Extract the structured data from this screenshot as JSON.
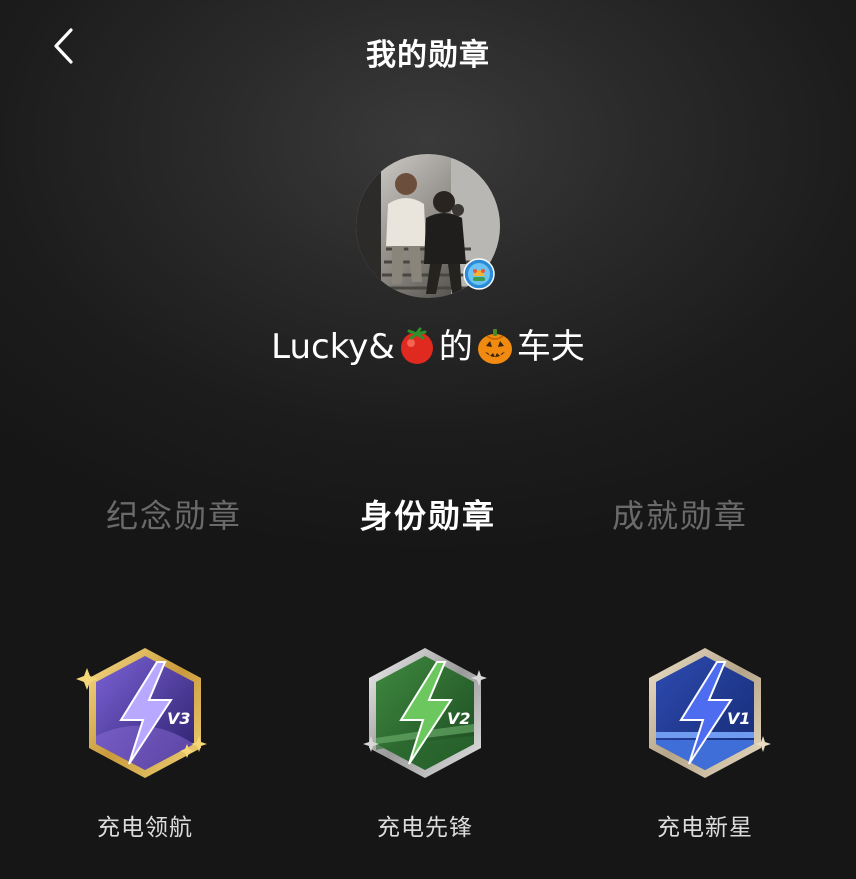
{
  "header": {
    "title": "我的勋章",
    "back_icon": "chevron-left-icon"
  },
  "profile": {
    "avatar": "user-photo-avatar",
    "name_parts": [
      "Lucky&",
      "的",
      "车夫"
    ],
    "name_emojis": [
      "tomato",
      "jack-o-lantern"
    ]
  },
  "tabs": [
    {
      "label": "纪念勋章",
      "active": false
    },
    {
      "label": "身份勋章",
      "active": true
    },
    {
      "label": "成就勋章",
      "active": false
    }
  ],
  "badges": [
    {
      "label": "充电领航",
      "level": "V3",
      "frame_color": "#d9b25a",
      "fill_color": "#5a3fa6"
    },
    {
      "label": "充电先锋",
      "level": "V2",
      "frame_color": "#c8c8c8",
      "fill_color": "#2f6b35"
    },
    {
      "label": "充电新星",
      "level": "V1",
      "frame_color": "#d8c8a8",
      "fill_color": "#203f9a"
    }
  ]
}
